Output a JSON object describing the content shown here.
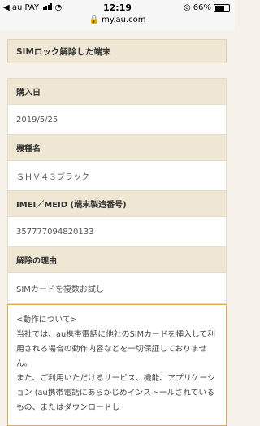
{
  "status": {
    "carrier": "au PAY",
    "time": "12:19",
    "url": "my.au.com",
    "battery": "66%"
  },
  "header": {
    "title": "SIMロック解除した端末"
  },
  "rows": [
    {
      "label": "購入日",
      "value": "2019/5/25"
    },
    {
      "label": "機種名",
      "value": "ＳＨＶ４３ブラック"
    },
    {
      "label": "IMEI／MEID (端末製造番号)",
      "value": "357777094820133"
    },
    {
      "label": "解除の理由",
      "value": "SIMカードを複数お試し"
    }
  ],
  "notice": {
    "heading": "<動作について>",
    "line1": "当社では、au携帯電話に他社のSIMカードを挿入して利用される場合の動作内容などを一切保証しておりません。",
    "line2": "また、ご利用いただけるサービス、機能、アプリケーション (au携帯電話にあらかじめインストールされているもの、またはダウンロードし"
  }
}
